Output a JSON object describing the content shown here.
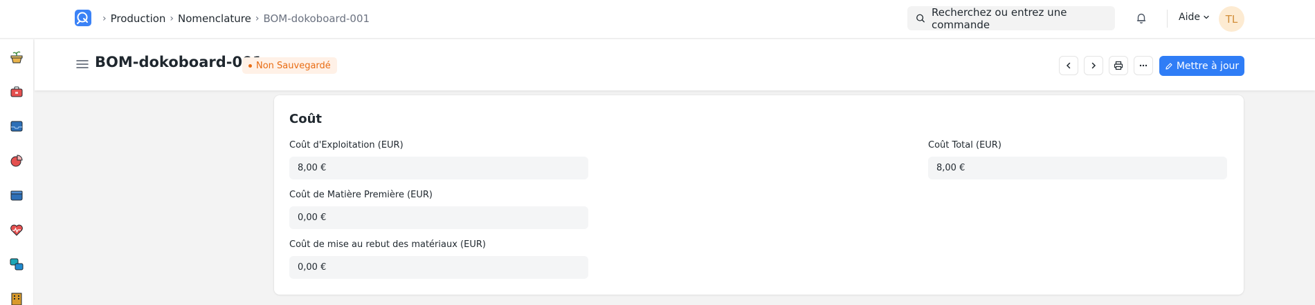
{
  "navbar": {
    "breadcrumbs": [
      "Production",
      "Nomenclature",
      "BOM-dokoboard-001"
    ],
    "search_placeholder": "Recherchez ou entrez une commande",
    "help_label": "Aide",
    "avatar_initials": "TL"
  },
  "sidebar": {
    "icons": [
      "plant-icon",
      "toolbox-icon",
      "inbox-icon",
      "pie-chart-icon",
      "archive-icon",
      "heart-monitor-icon",
      "shapes-icon",
      "building-icon"
    ]
  },
  "page": {
    "title": "BOM-dokoboard-001",
    "status_badge": "Non Sauvegardé",
    "primary_action": "Mettre à jour"
  },
  "section": {
    "title": "Coût",
    "fields_left": [
      {
        "label": "Coût d'Exploitation (EUR)",
        "value": "8,00 €"
      },
      {
        "label": "Coût de Matière Première (EUR)",
        "value": "0,00 €"
      },
      {
        "label": "Coût de mise au rebut des matériaux (EUR)",
        "value": "0,00 €"
      }
    ],
    "fields_right": [
      {
        "label": "Coût Total (EUR)",
        "value": "8,00 €"
      }
    ]
  },
  "colors": {
    "primary": "#2f7df6",
    "badge_text": "#e86c13",
    "badge_bg": "#fff1e7"
  }
}
